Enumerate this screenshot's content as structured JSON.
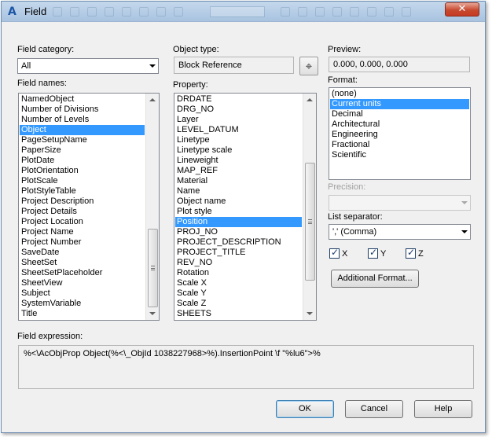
{
  "window": {
    "title": "Field",
    "close_glyph": "✕",
    "app_icon": "autocad-icon"
  },
  "field_category": {
    "label": "Field category:",
    "value": "All"
  },
  "field_names": {
    "label": "Field names:",
    "items": [
      "NamedObject",
      "Number of Divisions",
      "Number of Levels",
      "Object",
      "PageSetupName",
      "PaperSize",
      "PlotDate",
      "PlotOrientation",
      "PlotScale",
      "PlotStyleTable",
      "Project Description",
      "Project Details",
      "Project Location",
      "Project Name",
      "Project Number",
      "SaveDate",
      "SheetSet",
      "SheetSetPlaceholder",
      "SheetView",
      "Subject",
      "SystemVariable",
      "Title"
    ],
    "selected": "Object"
  },
  "object_type": {
    "label": "Object type:",
    "value": "Block Reference",
    "pick_icon": "pick-object-icon"
  },
  "property": {
    "label": "Property:",
    "items": [
      "DRDATE",
      "DRG_NO",
      "Layer",
      "LEVEL_DATUM",
      "Linetype",
      "Linetype scale",
      "Lineweight",
      "MAP_REF",
      "Material",
      "Name",
      "Object name",
      "Plot style",
      "Position",
      "PROJ_NO",
      "PROJECT_DESCRIPTION",
      "PROJECT_TITLE",
      "REV_NO",
      "Rotation",
      "Scale X",
      "Scale Y",
      "Scale Z",
      "SHEETS"
    ],
    "selected": "Position"
  },
  "preview": {
    "label": "Preview:",
    "value": "0.000, 0.000, 0.000"
  },
  "format": {
    "label": "Format:",
    "items": [
      "(none)",
      "Current units",
      "Decimal",
      "Architectural",
      "Engineering",
      "Fractional",
      "Scientific"
    ],
    "selected": "Current units"
  },
  "precision": {
    "label": "Precision:",
    "value": ""
  },
  "list_separator": {
    "label": "List separator:",
    "value": "',' (Comma)"
  },
  "checkboxes": [
    {
      "label": "X",
      "checked": true
    },
    {
      "label": "Y",
      "checked": true
    },
    {
      "label": "Z",
      "checked": true
    }
  ],
  "check_glyph": "✓",
  "additional_format_button": "Additional Format...",
  "field_expression": {
    "label": "Field expression:",
    "value": "%<\\AcObjProp Object(%<\\_ObjId 1038227968>%).InsertionPoint \\f \"%lu6\">%"
  },
  "buttons": {
    "ok": "OK",
    "cancel": "Cancel",
    "help": "Help"
  },
  "colors": {
    "selection": "#3399ff",
    "title_bar": "#b7cde6",
    "close_button": "#c7492f"
  }
}
